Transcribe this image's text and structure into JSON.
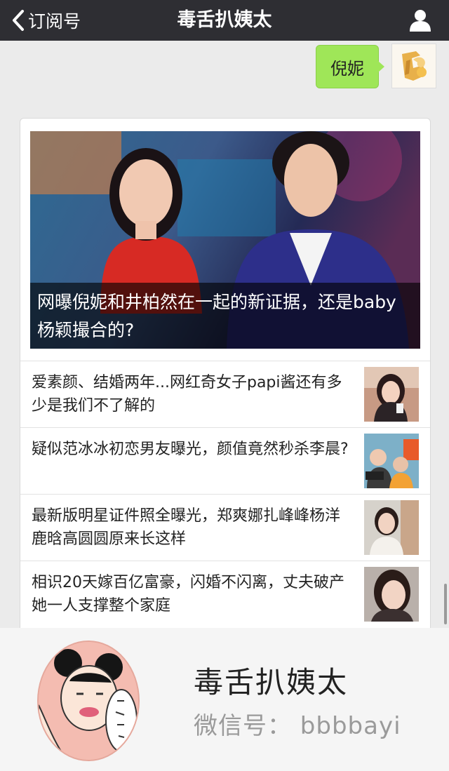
{
  "nav": {
    "back_label": "订阅号",
    "title": "毒舌扒姨太",
    "back_icon": "chevron-left-icon",
    "profile_icon": "person-icon"
  },
  "message": {
    "text": "倪妮"
  },
  "cover_article": {
    "title": "网曝倪妮和井柏然在一起的新证据，还是baby杨颖撮合的?"
  },
  "articles": [
    {
      "title": "爱素颜、结婚两年...网红奇女子papi酱还有多少是我们不了解的"
    },
    {
      "title": "疑似范冰冰初恋男友曝光，颜值竟然秒杀李晨?"
    },
    {
      "title": "最新版明星证件照全曝光，郑爽娜扎峰峰杨洋鹿晗高圆圆原来长这样"
    },
    {
      "title": "相识20天嫁百亿富豪，闪婚不闪离，丈夫破产她一人支撑整个家庭"
    }
  ],
  "footer": {
    "name": "毒舌扒姨太",
    "wechat_id": "微信号： bbbbayi"
  },
  "colors": {
    "navbar": "#2e2e33",
    "bubble": "#9fe658",
    "background": "#ebebeb"
  }
}
